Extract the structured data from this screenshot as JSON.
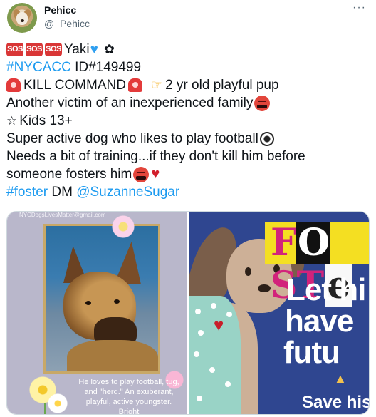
{
  "author": {
    "display_name": "Pehicc",
    "handle": "@_Pehicc",
    "more_label": "···"
  },
  "tweet": {
    "line1": {
      "sos": [
        "SOS",
        "SOS",
        "SOS"
      ],
      "text": "Yaki"
    },
    "line2": {
      "hashtag": "#NYCACC",
      "text": " ID#149499"
    },
    "line3": {
      "text_a": "KILL COMMAND",
      "text_b": "2 yr old playful pup"
    },
    "line4": {
      "text": "Another victim of an inexperienced family"
    },
    "line5": {
      "text": "Kids 13+"
    },
    "line6": {
      "text": "Super active dog who likes to play football"
    },
    "line7": {
      "text": "Needs a bit of training...if they don't kill him before"
    },
    "line8": {
      "text": "someone fosters him"
    },
    "line9": {
      "hashtag": "#foster",
      "text": " DM ",
      "mention": "@SuzanneSugar"
    }
  },
  "icons": {
    "heart": "blue-heart-icon",
    "paw": "paw-prints-icon",
    "siren": "police-light-icon",
    "pointing": "pointing-right-icon",
    "angry": "swearing-face-icon",
    "kids": "kids-icon",
    "ball": "soccer-ball-icon",
    "broken": "broken-heart-icon",
    "pray": "praying-hands-icon"
  },
  "media": {
    "left": {
      "watermark": "NYCDogsLivesMatter@gmail.com",
      "caption": "He loves to play football, tug, and \"herd.\" An exuberant, playful, active youngster. Bright"
    },
    "right": {
      "banner": {
        "f": "F",
        "o": "O",
        "st": "ST",
        "e": "e"
      },
      "lines": [
        "Let hi",
        "have",
        "futu"
      ],
      "save": "Save his"
    }
  },
  "colors": {
    "link": "#1d9bf0",
    "text": "#0f1419",
    "muted": "#536471",
    "poster_blue": "#2f4690"
  }
}
